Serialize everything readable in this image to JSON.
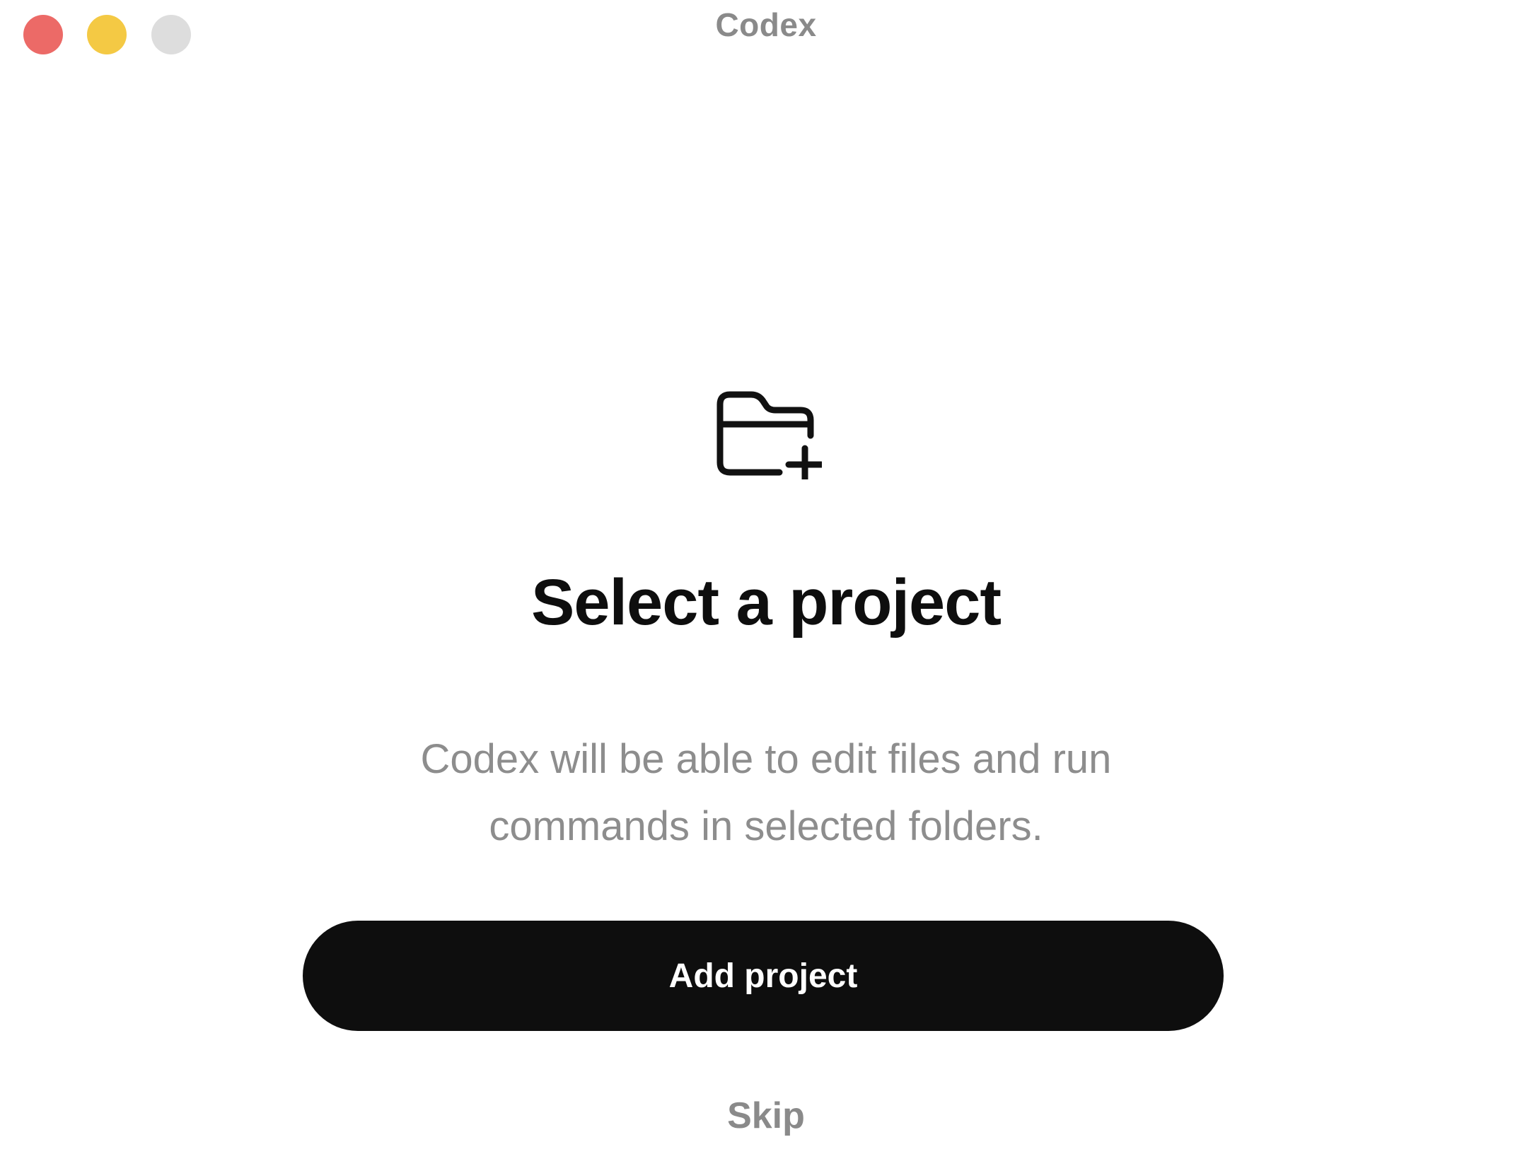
{
  "window": {
    "title": "Codex"
  },
  "main": {
    "icon": "folder-plus-icon",
    "heading": "Select a project",
    "description": "Codex will be able to edit files and run commands in selected folders.",
    "primary_button_label": "Add project",
    "skip_label": "Skip"
  },
  "colors": {
    "close": "#ec6a67",
    "minimize": "#f4c944",
    "zoom": "#dddddd",
    "button_bg": "#0e0e0e"
  }
}
